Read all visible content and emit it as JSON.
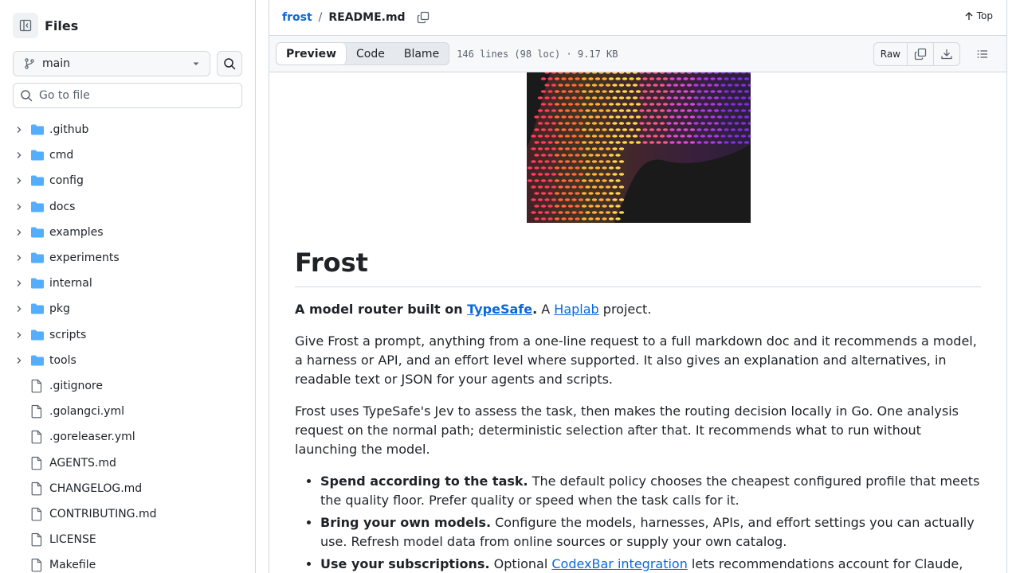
{
  "sidebar": {
    "title": "Files",
    "branch": "main",
    "goto_placeholder": "Go to file",
    "folders": [
      ".github",
      "cmd",
      "config",
      "docs",
      "examples",
      "experiments",
      "internal",
      "pkg",
      "scripts",
      "tools"
    ],
    "files": [
      ".gitignore",
      ".golangci.yml",
      ".goreleaser.yml",
      "AGENTS.md",
      "CHANGELOG.md",
      "CONTRIBUTING.md",
      "LICENSE",
      "Makefile"
    ]
  },
  "header": {
    "repo": "frost",
    "separator": "/",
    "file": "README.md",
    "top_label": "Top"
  },
  "toolbar": {
    "tabs": [
      "Preview",
      "Code",
      "Blame"
    ],
    "file_info": "146 lines (98 loc) · 9.17 KB",
    "raw_label": "Raw"
  },
  "readme": {
    "title": "Frost",
    "tagline_bold": "A model router built on ",
    "tagline_link": "TypeSafe",
    "tagline_dot": ".",
    "tagline_mid": " A ",
    "tagline_link2": "Haplab",
    "tagline_end": " project.",
    "para1": "Give Frost a prompt, anything from a one-line request to a full markdown doc and it recommends a model, a harness or API, and an effort level where supported. It also gives an explanation and alternatives, in readable text or JSON for your agents and scripts.",
    "para2": "Frost uses TypeSafe's Jev to assess the task, then makes the routing decision locally in Go. One analysis request on the normal path; deterministic selection after that. It recommends what to run without launching the model.",
    "bullets": [
      {
        "bold": "Spend according to the task.",
        "text": " The default policy chooses the cheapest configured profile that meets the quality floor. Prefer quality or speed when the task calls for it."
      },
      {
        "bold": "Bring your own models.",
        "text": " Configure the models, harnesses, APIs, and effort settings you can actually use. Refresh model data from online sources or supply your own catalog."
      },
      {
        "bold": "Use your subscriptions.",
        "text": " Optional ",
        "link": "CodexBar integration",
        "text2": " lets recommendations account for Claude,"
      }
    ]
  },
  "colors": {
    "accent": "#0969da",
    "folder": "#54aeff",
    "border": "#d1d9e0",
    "muted": "#59636e"
  }
}
